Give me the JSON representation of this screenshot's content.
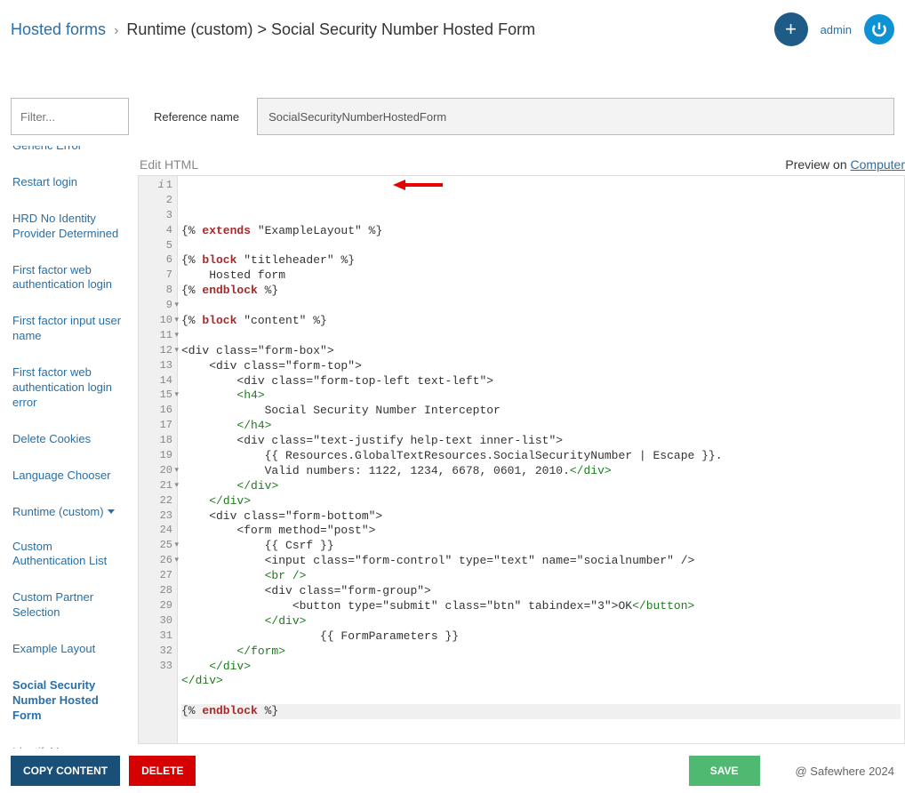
{
  "breadcrumb": {
    "root": "Hosted forms",
    "mid": "Runtime (custom)",
    "leaf": "Social Security Number Hosted Form"
  },
  "header": {
    "user": "admin"
  },
  "toolbar": {
    "filter_placeholder": "Filter...",
    "ref_label": "Reference name",
    "ref_value": "SocialSecurityNumberHostedForm"
  },
  "sidebar": {
    "items": [
      "Generic Error",
      "Restart login",
      "HRD No Identity Provider Determined",
      "First factor web authentication login",
      "First factor input user name",
      "First factor web authentication login error",
      "Delete Cookies",
      "Language Chooser"
    ],
    "group": "Runtime (custom)",
    "subitems": [
      "Custom Authentication List",
      "Custom Partner Selection",
      "Example Layout",
      "Social Security Number Hosted Form",
      "IdentifyMe"
    ]
  },
  "editor": {
    "title": "Edit HTML",
    "preview_label": "Preview on ",
    "preview_target": "Computer",
    "line_count": 33,
    "fold_lines": [
      9,
      10,
      11,
      12,
      15,
      20,
      21,
      25,
      26
    ],
    "cursor_line": 33
  },
  "code": [
    "{% extends \"ExampleLayout\" %}",
    "",
    "{% block \"titleheader\" %}",
    "    Hosted form",
    "{% endblock %}",
    "",
    "{% block \"content\" %}",
    "",
    "<div class=\"form-box\">",
    "    <div class=\"form-top\">",
    "        <div class=\"form-top-left text-left\">",
    "        <h4>",
    "            Social Security Number Interceptor",
    "        </h4>",
    "        <div class=\"text-justify help-text inner-list\">",
    "            {{ Resources.GlobalTextResources.SocialSecurityNumber | Escape }}.",
    "            Valid numbers: 1122, 1234, 6678, 0601, 2010.</div>",
    "        </div>",
    "    </div>",
    "    <div class=\"form-bottom\">",
    "        <form method=\"post\">",
    "            {{ Csrf }}",
    "            <input class=\"form-control\" type=\"text\" name=\"socialnumber\" />",
    "            <br />",
    "            <div class=\"form-group\">",
    "                <button type=\"submit\" class=\"btn\" tabindex=\"3\">OK</button>",
    "            </div>",
    "                    {{ FormParameters }}",
    "        </form>",
    "    </div>",
    "</div>",
    "",
    "{% endblock %}"
  ],
  "footer": {
    "copy": "COPY CONTENT",
    "delete": "DELETE",
    "save": "SAVE",
    "brand": "@ Safewhere 2024"
  }
}
